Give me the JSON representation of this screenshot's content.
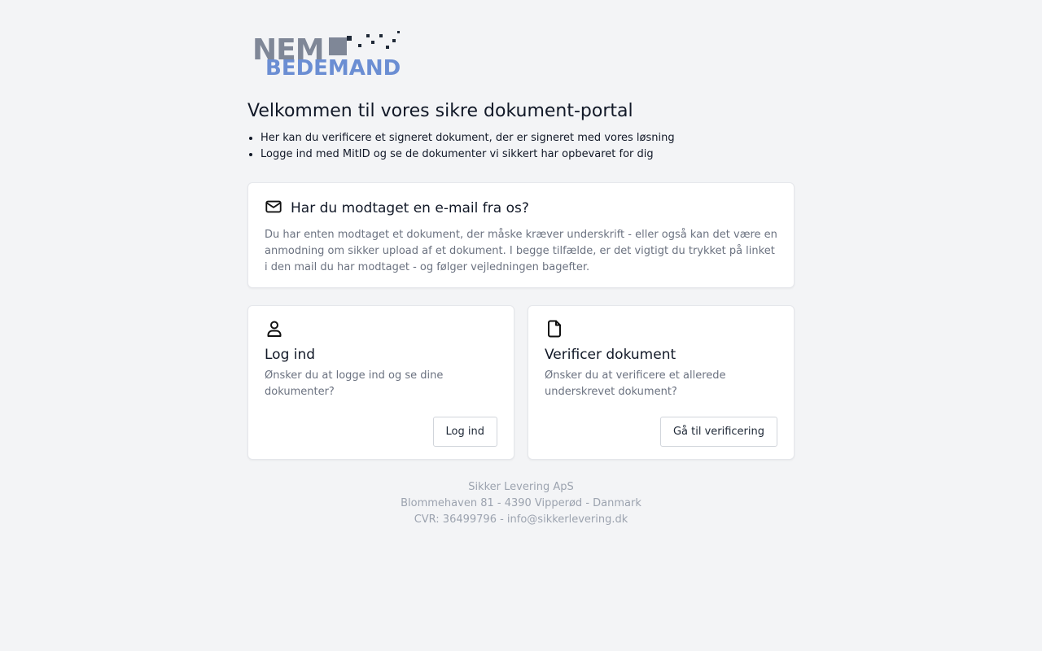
{
  "logo": {
    "line1": "NEM",
    "line2": "BEDEMAND"
  },
  "heading": "Velkommen til vores sikre dokument-portal",
  "intro": [
    "Her kan du verificere et signeret dokument, der er signeret med vores løsning",
    "Logge ind med MitID og se de dokumenter vi sikkert har opbevaret for dig"
  ],
  "email_card": {
    "title": "Har du modtaget en e-mail fra os?",
    "description": "Du har enten modtaget et dokument, der måske kræver underskrift - eller også kan det være en anmodning om sikker upload af et dokument. I begge tilfælde, er det vigtigt du trykket på linket i den mail du har modtaget - og følger vejledningen bagefter.",
    "icon": "mail-icon"
  },
  "login_card": {
    "title": "Log ind",
    "description": "Ønsker du at logge ind og se dine dokumenter?",
    "button": "Log ind",
    "icon": "user-icon"
  },
  "verify_card": {
    "title": "Verificer dokument",
    "description": "Ønsker du at verificere et allerede underskrevet dokument?",
    "button": "Gå til verificering",
    "icon": "document-icon"
  },
  "footer": {
    "company": "Sikker Levering ApS",
    "address": "Blommehaven 81 - 4390 Vipperød - Danmark",
    "cvr": "CVR: 36499796 - info@sikkerlevering.dk"
  },
  "colors": {
    "background": "#f3f4f6",
    "logo_gray": "#7f8797",
    "logo_blue": "#6b8ed3",
    "muted_text": "#6b7280"
  }
}
